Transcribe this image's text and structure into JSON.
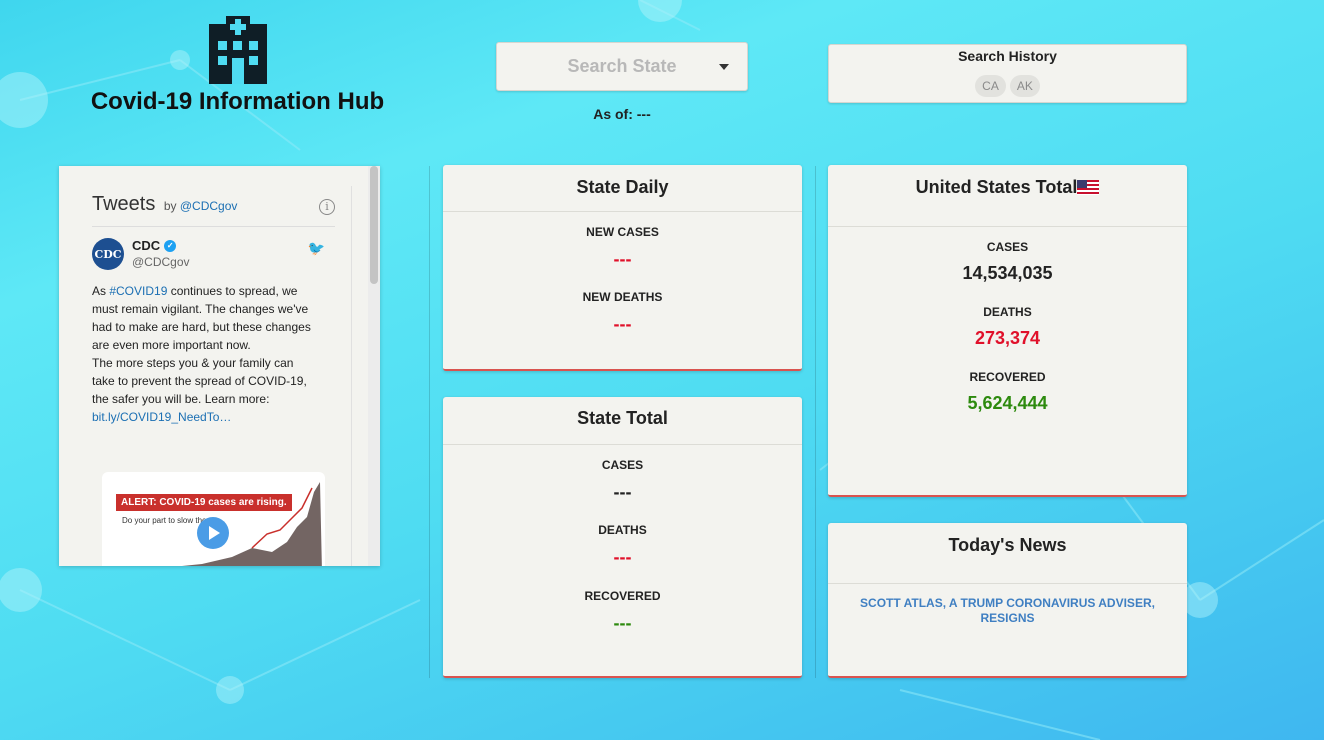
{
  "brand": {
    "title": "Covid-19 Information Hub",
    "icon": "hospital-icon"
  },
  "search": {
    "placeholder": "Search State",
    "as_of_label": "As of: ---"
  },
  "history": {
    "title": "Search History",
    "chips": [
      "CA",
      "AK"
    ]
  },
  "tweets": {
    "title": "Tweets",
    "by": "by",
    "handle_link": "@CDCgov",
    "author_name": "CDC",
    "author_handle": "@CDCgov",
    "logo_text": "CDC",
    "text_before": "As ",
    "hashtag": "#COVID19",
    "text_main": " continues to spread, we must remain vigilant. The changes we've had to make are hard, but these changes are even more important now.",
    "text_second": "The more steps you & your family can take to prevent the spread of COVID-19, the safer you will be. Learn more:",
    "link": "bit.ly/COVID19_NeedTo…",
    "media_alert": "ALERT: COVID-19 cases are rising.",
    "media_sub": "Do your part to slow the s"
  },
  "state_daily": {
    "title": "State Daily",
    "new_cases_label": "NEW CASES",
    "new_cases_value": "---",
    "new_deaths_label": "NEW DEATHS",
    "new_deaths_value": "---"
  },
  "state_total": {
    "title": "State Total",
    "cases_label": "CASES",
    "cases_value": "---",
    "deaths_label": "DEATHS",
    "deaths_value": "---",
    "recovered_label": "RECOVERED",
    "recovered_value": "---"
  },
  "us_total": {
    "title": "United States Total",
    "flag_icon": "us-flag-icon",
    "cases_label": "CASES",
    "cases_value": "14,534,035",
    "deaths_label": "DEATHS",
    "deaths_value": "273,374",
    "recovered_label": "RECOVERED",
    "recovered_value": "5,624,444"
  },
  "news": {
    "title": "Today's News",
    "headline": "SCOTT ATLAS, A TRUMP CORONAVIRUS ADVISER, RESIGNS"
  },
  "colors": {
    "accent_red": "#e0102a",
    "accent_green": "#2d8a0e",
    "link_blue": "#3f7fc2",
    "card_bg": "#f3f3ef"
  }
}
